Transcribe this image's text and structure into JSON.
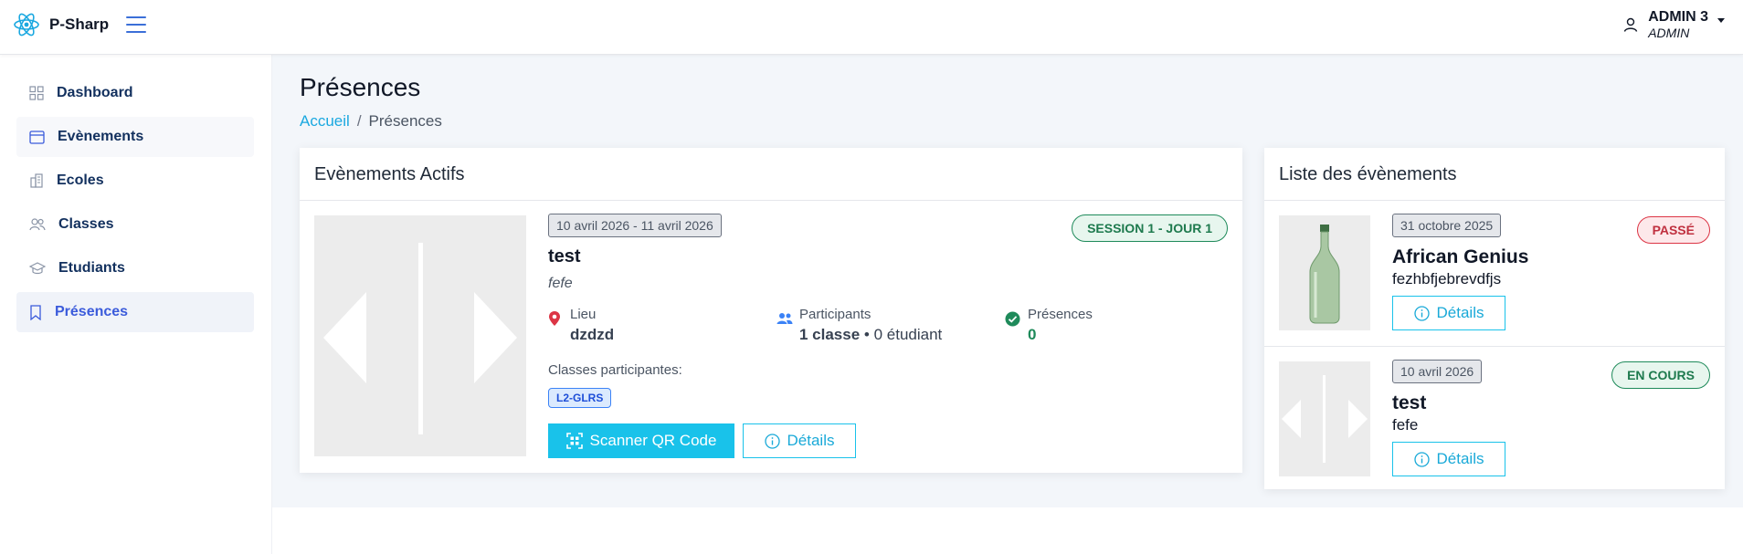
{
  "app": {
    "name": "P-Sharp"
  },
  "user": {
    "name": "ADMIN 3",
    "role": "ADMIN"
  },
  "sidebar": {
    "items": [
      {
        "label": "Dashboard",
        "icon": "grid-icon"
      },
      {
        "label": "Evènements",
        "icon": "calendar-icon"
      },
      {
        "label": "Ecoles",
        "icon": "building-icon"
      },
      {
        "label": "Classes",
        "icon": "users-icon"
      },
      {
        "label": "Etudiants",
        "icon": "graduation-cap-icon"
      },
      {
        "label": "Présences",
        "icon": "bookmark-icon"
      }
    ]
  },
  "page": {
    "title": "Présences",
    "breadcrumb": {
      "home": "Accueil",
      "separator": "/",
      "current": "Présences"
    }
  },
  "active_events": {
    "title": "Evènements Actifs",
    "event": {
      "date_range": "10 avril 2026 - 11 avril 2026",
      "session_badge": "SESSION 1 - JOUR 1",
      "title": "test",
      "description": "fefe",
      "location_label": "Lieu",
      "location_value": "dzdzd",
      "participants_label": "Participants",
      "participants_classes": "1 classe",
      "participants_sep": "•",
      "participants_students": "0 étudiant",
      "presences_label": "Présences",
      "presences_value": "0",
      "classes_label": "Classes participantes:",
      "class_tag": "L2-GLRS",
      "scan_button": "Scanner QR Code",
      "details_button": "Détails"
    }
  },
  "events_list": {
    "title": "Liste des évènements",
    "items": [
      {
        "date": "31 octobre 2025",
        "status": "PASSÉ",
        "title": "African Genius",
        "description": "fezhbfjebrevdfjs",
        "details": "Détails"
      },
      {
        "date": "10 avril 2026",
        "status": "EN COURS",
        "title": "test",
        "description": "fefe",
        "details": "Détails"
      }
    ]
  },
  "colors": {
    "accent": "#19c2ea",
    "nav": "#12305e",
    "active_nav": "#3b5bdb",
    "success": "#1e8a5a",
    "danger": "#dc3545"
  }
}
